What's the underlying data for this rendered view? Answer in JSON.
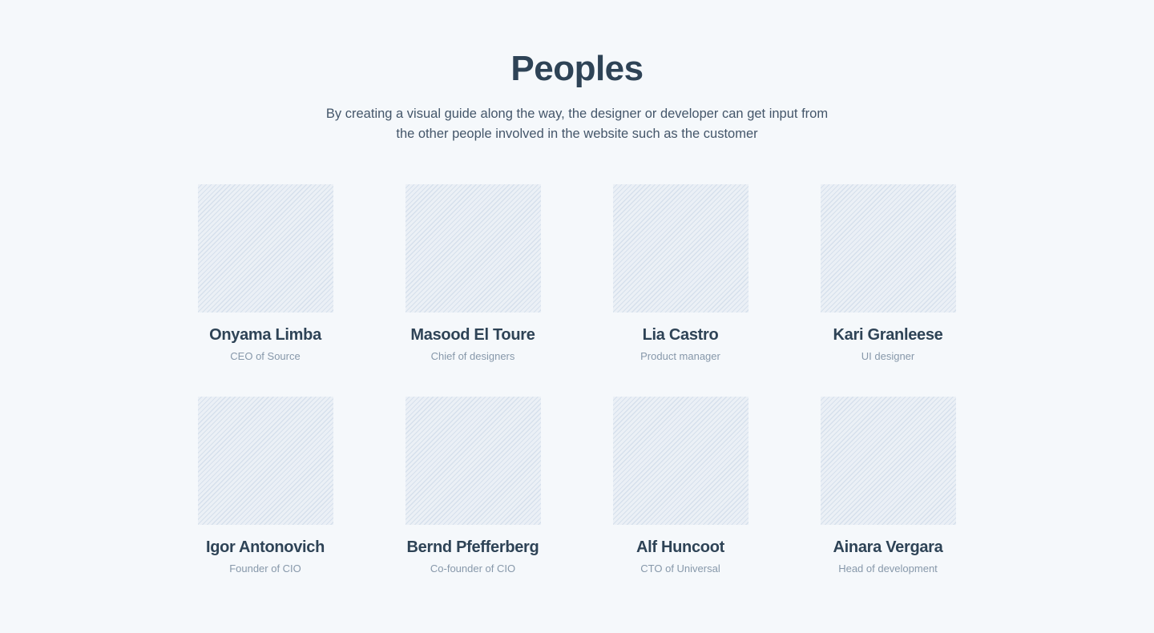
{
  "section": {
    "title": "Peoples",
    "subtitle_line1": "By creating a visual guide along the way, the designer or developer can get input from",
    "subtitle_line2": "the other people involved in the website such as the customer"
  },
  "people": [
    {
      "name": "Onyama Limba",
      "role": "CEO of Source"
    },
    {
      "name": "Masood El Toure",
      "role": "Chief of designers"
    },
    {
      "name": "Lia Castro",
      "role": "Product manager"
    },
    {
      "name": "Kari Granleese",
      "role": "UI designer"
    },
    {
      "name": "Igor Antonovich",
      "role": "Founder of CIO"
    },
    {
      "name": "Bernd Pfefferberg",
      "role": "Co-founder of CIO"
    },
    {
      "name": "Alf Huncoot",
      "role": "CTO of Universal"
    },
    {
      "name": "Ainara Vergara",
      "role": "Head of development"
    }
  ],
  "colors": {
    "background": "#f5f8fb",
    "heading": "#2e4356",
    "body_text": "#44566a",
    "muted_text": "#8798aa",
    "placeholder_fill": "#ebf0f6",
    "placeholder_stripe": "#d6e0ec"
  }
}
